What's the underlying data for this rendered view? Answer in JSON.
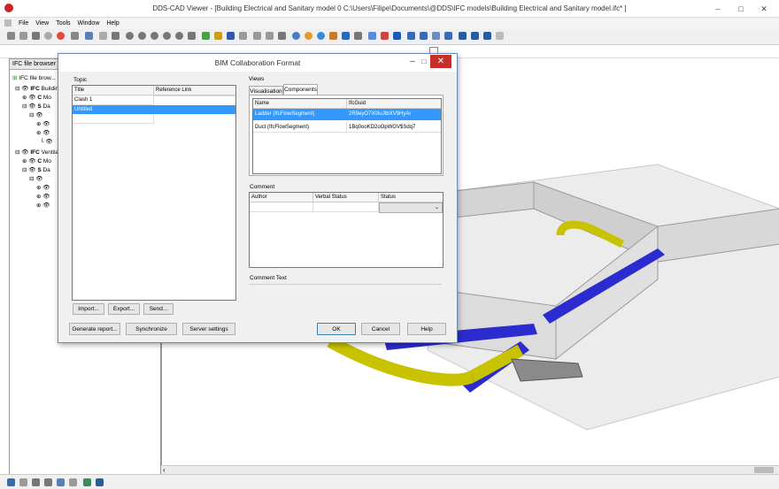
{
  "window": {
    "title": "DDS-CAD Viewer - [Building Electrical and Sanitary model  0  C:\\Users\\Filipe\\Documents\\@DDS\\IFC models\\Building Electrical and Sanitary model.ifc* ]"
  },
  "menu": [
    "File",
    "View",
    "Tools",
    "Window",
    "Help"
  ],
  "left_panel": {
    "header": "IFC file browser",
    "tree_header": "IFC file brow...",
    "tree": [
      {
        "label": "Buildin"
      },
      {
        "label": "Mo"
      },
      {
        "label": "Da"
      },
      {
        "label": "Ventila"
      },
      {
        "label": "Mo"
      },
      {
        "label": "Da"
      }
    ]
  },
  "dialog": {
    "title": "BIM Collaboration Format",
    "topic": {
      "label": "Topic",
      "columns": [
        "Title",
        "Reference Link"
      ],
      "rows": [
        {
          "title": "Clash 1",
          "link": ""
        },
        {
          "title": "Untitled",
          "link": ""
        }
      ],
      "buttons": [
        "Import...",
        "Export...",
        "Send..."
      ]
    },
    "views": {
      "label": "Views",
      "tabs": [
        "Visualisation",
        "Components"
      ],
      "columns": [
        "Name",
        "IfcGuid"
      ],
      "rows": [
        {
          "name": "Ladder (IfcFlowSegment)",
          "guid": "2R9eyO7X0IuJtbXV9HyAr"
        },
        {
          "name": "Duct (IfcFlowSegment)",
          "guid": "1Bq0ooKD2oOpWGV$Sdq7"
        }
      ]
    },
    "comment": {
      "label": "Comment",
      "columns": [
        "Author",
        "Verbal Status",
        "Status"
      ],
      "text_label": "Comment Text"
    },
    "footer_buttons": [
      "Generate report...",
      "Synchronize",
      "Server settings"
    ],
    "action_buttons": [
      "OK",
      "Cancel",
      "Help"
    ]
  },
  "colors": {
    "selection": "#3399ff",
    "close": "#c7302a",
    "pipe_blue": "#2b2bd0",
    "pipe_yellow": "#c9c200"
  }
}
